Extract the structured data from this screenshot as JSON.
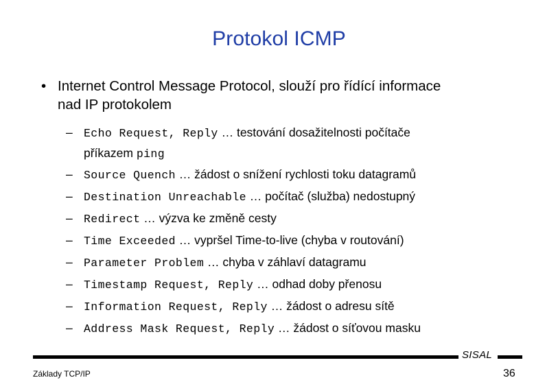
{
  "slide": {
    "title": "Protokol ICMP",
    "bullet_marker": "•",
    "dash_marker": "–",
    "title_color": "#1f3da6",
    "main_bullet": {
      "line1": "Internet Control Message Protocol, slouží pro řídící informace",
      "line2": "nad IP protokolem"
    },
    "sub_items": [
      {
        "code": "Echo Request, Reply",
        "text": " … testování dosažitelnosti počítače",
        "second_line_text": "příkazem ",
        "second_line_code": "ping"
      },
      {
        "code": "Source Quench",
        "text": " … žádost o snížení rychlosti toku datagramů"
      },
      {
        "code": "Destination Unreachable",
        "text": " … počítač (služba) nedostupný"
      },
      {
        "code": "Redirect",
        "text": " … výzva ke změně cesty"
      },
      {
        "code": "Time Exceeded",
        "text": " … vypršel Time-to-live (chyba v routování)"
      },
      {
        "code": "Parameter Problem",
        "text": " … chyba v záhlaví datagramu"
      },
      {
        "code": "Timestamp Request, Reply",
        "text": " … odhad doby přenosu"
      },
      {
        "code": "Information Request, Reply",
        "text": " … žádost o adresu sítě"
      },
      {
        "code": "Address Mask Request, Reply",
        "text": " … žádost o síťovou masku"
      }
    ],
    "footer": {
      "left_text": "Základy TCP/IP",
      "brand": "SISAL",
      "page_number": "36"
    }
  }
}
